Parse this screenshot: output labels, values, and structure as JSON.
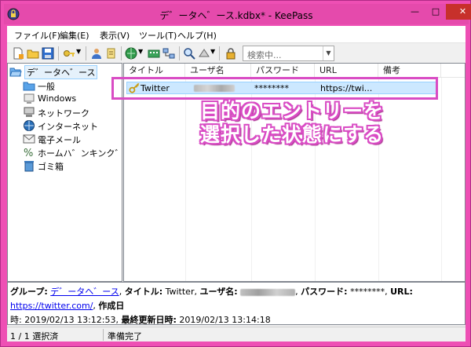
{
  "window": {
    "title": "デ゛ータヘ゛ース.kdbx* - KeePass"
  },
  "menu": [
    {
      "label": "ファイル(F)"
    },
    {
      "label": "編集(E)"
    },
    {
      "label": "表示(V)"
    },
    {
      "label": "ツール(T)"
    },
    {
      "label": "ヘルプ(H)"
    }
  ],
  "toolbar": {
    "search_placeholder": "検索中..."
  },
  "tree": [
    {
      "label": "デ゛ータヘ゛ース",
      "icon": "folder-open-icon",
      "root": true
    },
    {
      "label": "一般",
      "icon": "folder-icon"
    },
    {
      "label": "Windows",
      "icon": "windows-icon"
    },
    {
      "label": "ネットワーク",
      "icon": "network-icon"
    },
    {
      "label": "インターネット",
      "icon": "internet-icon"
    },
    {
      "label": "電子メール",
      "icon": "email-icon"
    },
    {
      "label": "ホームハ゛ンキンク゛",
      "icon": "banking-icon"
    },
    {
      "label": "ゴミ箱",
      "icon": "recycle-bin-icon"
    }
  ],
  "columns": [
    "タイトル",
    "ユーザ名",
    "パスワード",
    "URL",
    "備考"
  ],
  "entry": {
    "title": "Twitter",
    "password": "********",
    "url": "https://twi..."
  },
  "annotation": {
    "line1": "目的のエントリーを",
    "line2": "選択した状態にする"
  },
  "details": {
    "group_label": "グループ:",
    "group_value": "デ゛ータヘ゛ース",
    "title_label": "タイトル:",
    "title_value": "Twitter,",
    "user_label": "ユーザ名:",
    "password_label": "パスワード:",
    "password_value": "********,",
    "url_label": "URL:",
    "url_value": "https://twitter.com/",
    "created_label": "作成日",
    "created_value": "時: 2019/02/13 13:12:53,",
    "modified_label": "最終更新日時:",
    "modified_value": "2019/02/13 13:14:18"
  },
  "status": {
    "selection": "1 / 1 選択済",
    "ready": "準備完了"
  },
  "colors": {
    "window_frame": "#ee4fb4",
    "selection": "#cce8ff",
    "annotation_outline": "#d94cc4"
  }
}
